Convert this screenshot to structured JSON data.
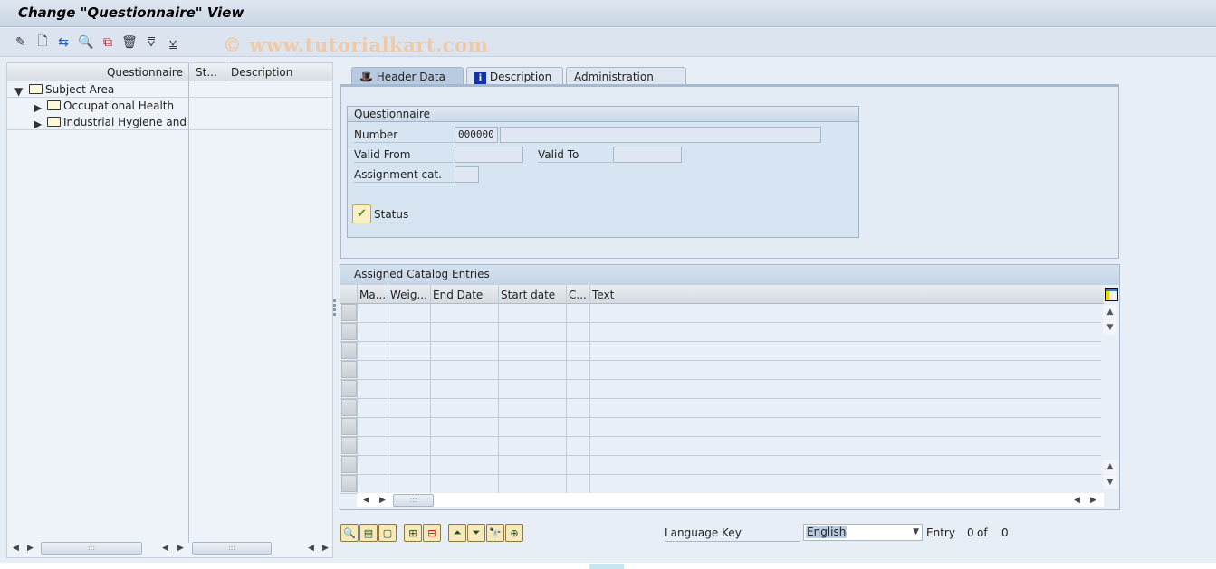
{
  "window": {
    "title": "Change \"Questionnaire\" View"
  },
  "toolbar": {
    "icons": [
      "edit-pencil-icon",
      "new-document-icon",
      "move-icon",
      "display-icon",
      "copy-icon",
      "delete-trash-icon",
      "expand-all-icon",
      "collapse-all-icon"
    ],
    "watermark": "© www.tutorialkart.com"
  },
  "tree": {
    "columns": [
      "Questionnaire",
      "St...",
      "Description"
    ],
    "nodes": [
      {
        "label": "Subject Area",
        "expanded": true,
        "level": 0
      },
      {
        "label": "Occupational Health",
        "expanded": false,
        "level": 1
      },
      {
        "label": "Industrial Hygiene and Sa",
        "expanded": false,
        "level": 1
      }
    ]
  },
  "tabs": [
    {
      "label": "Header Data",
      "icon": "hat-icon",
      "active": true
    },
    {
      "label": "Description",
      "icon": "info-icon",
      "active": false
    },
    {
      "label": "Administration Data",
      "icon": "",
      "active": false
    }
  ],
  "questionnaire": {
    "group_title": "Questionnaire",
    "number_label": "Number",
    "number_value": "000000",
    "number_text": "",
    "valid_from_label": "Valid From",
    "valid_from_value": "",
    "valid_to_label": "Valid To",
    "valid_to_value": "",
    "assignment_label": "Assignment cat.",
    "assignment_value": "",
    "status_label": "Status"
  },
  "catalog": {
    "title": "Assigned Catalog Entries",
    "columns": [
      "Ma...",
      "Weig...",
      "End Date",
      "Start date",
      "C...",
      "Text"
    ],
    "rows": [
      [],
      [],
      [],
      [],
      [],
      [],
      [],
      [],
      [],
      []
    ]
  },
  "bottom_toolbar": {
    "icons": [
      "details-icon",
      "select-all-icon",
      "deselect-all-icon",
      "insert-row-icon",
      "delete-row-icon",
      "sort-ascending-icon",
      "filter-icon",
      "find-icon",
      "find-next-icon"
    ]
  },
  "language": {
    "label": "Language Key",
    "selected": "English"
  },
  "entry": {
    "label": "Entry",
    "current": "0",
    "of_label": "of",
    "total": "0"
  }
}
